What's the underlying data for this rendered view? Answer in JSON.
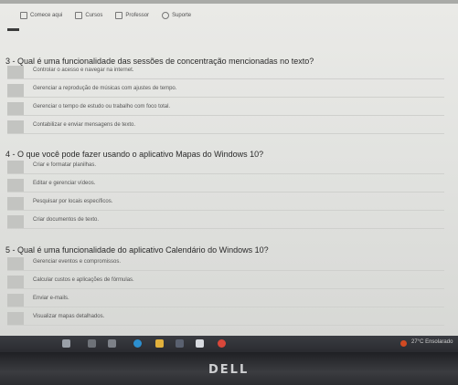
{
  "browser": {
    "tabs": [
      {
        "label": "Comece aqui",
        "icon": "bookmark-icon"
      },
      {
        "label": "Cursos",
        "icon": "grid-icon"
      },
      {
        "label": "Professor",
        "icon": "book-icon"
      },
      {
        "label": "Suporte",
        "icon": "help-icon"
      }
    ]
  },
  "questions": [
    {
      "text": "3 - Qual é uma funcionalidade das sessões de concentração mencionadas no texto?",
      "options": [
        "Controlar o acesso e navegar na internet.",
        "Gerenciar a reprodução de músicas com ajustes de tempo.",
        "Gerenciar o tempo de estudo ou trabalho com foco total.",
        "Contabilizar e enviar mensagens de texto."
      ]
    },
    {
      "text": "4 - O que você pode fazer usando o aplicativo Mapas do Windows 10?",
      "options": [
        "Criar e formatar planilhas.",
        "Editar e gerenciar vídeos.",
        "Pesquisar por locais específicos.",
        "Criar documentos de texto."
      ]
    },
    {
      "text": "5 - Qual é uma funcionalidade do aplicativo Calendário do Windows 10?",
      "options": [
        "Gerenciar eventos e compromissos.",
        "Calcular custos e aplicações de fórmulas.",
        "Enviar e-mails.",
        "Visualizar mapas detalhados."
      ]
    }
  ],
  "taskbar": {
    "weather": "27°C Ensolarado",
    "icons": [
      "start-icon",
      "search-icon",
      "task-view-icon",
      "edge-icon",
      "file-explorer-icon",
      "store-icon",
      "mail-icon",
      "chrome-icon"
    ]
  },
  "brand": {
    "logo_text": "DELL"
  },
  "colors": {
    "taskbar": "#2f3035",
    "weather_icon": "#d14a22",
    "page_bg": "#e4e5e2"
  }
}
